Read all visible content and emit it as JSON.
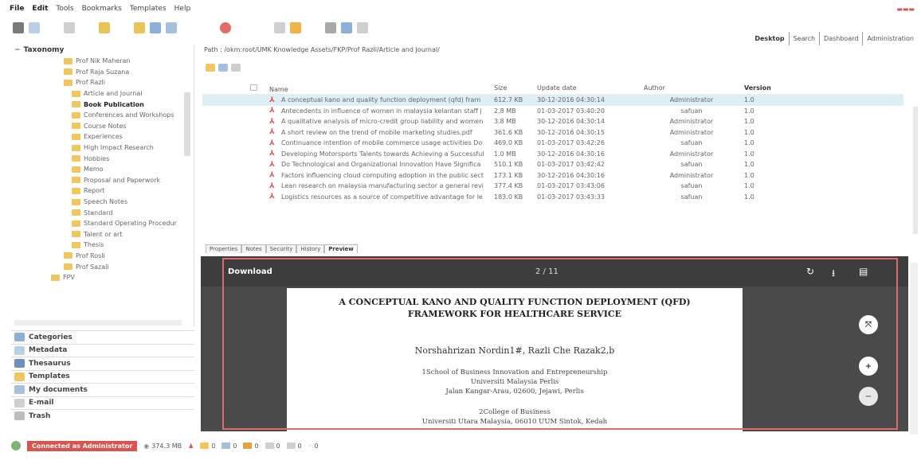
{
  "menu": [
    "File",
    "Edit",
    "Tools",
    "Bookmarks",
    "Templates",
    "Help"
  ],
  "nav_tabs": [
    "Desktop",
    "Search",
    "Dashboard",
    "Administration"
  ],
  "taxonomy": {
    "title": "Taxonomy",
    "items": [
      {
        "label": "Prof Nik Maheran",
        "indent": 1
      },
      {
        "label": "Prof Raja Suzana",
        "indent": 1
      },
      {
        "label": "Prof Razli",
        "indent": 1
      },
      {
        "label": "Article and Journal",
        "indent": 2
      },
      {
        "label": "Book Publication",
        "indent": 2
      },
      {
        "label": "Conferences and Workshops",
        "indent": 2
      },
      {
        "label": "Course Notes",
        "indent": 2
      },
      {
        "label": "Experiences",
        "indent": 2
      },
      {
        "label": "High Impact Research",
        "indent": 2
      },
      {
        "label": "Hobbies",
        "indent": 2
      },
      {
        "label": "Memo",
        "indent": 2
      },
      {
        "label": "Proposal and Paperwork",
        "indent": 2
      },
      {
        "label": "Report",
        "indent": 2
      },
      {
        "label": "Speech Notes",
        "indent": 2
      },
      {
        "label": "Standard",
        "indent": 2
      },
      {
        "label": "Standard Operating Procedur",
        "indent": 2
      },
      {
        "label": "Talent or art",
        "indent": 2
      },
      {
        "label": "Thesis",
        "indent": 2
      },
      {
        "label": "Prof Rosli",
        "indent": 1
      },
      {
        "label": "Prof Sazali",
        "indent": 1
      },
      {
        "label": "FPV",
        "indent": 0
      }
    ]
  },
  "accordion": [
    "Categories",
    "Metadata",
    "Thesaurus",
    "Templates",
    "My documents",
    "E-mail",
    "Trash"
  ],
  "status": {
    "connected": "Connected as Administrator",
    "size": "374.3 MB",
    "counts": [
      "0",
      "0",
      "0",
      "0",
      "0",
      "0"
    ]
  },
  "path": "Path : /okm:root/UMK Knowledge Assets/FKP/Prof Razli/Article and Journal/",
  "files": {
    "headers": {
      "name": "Name",
      "size": "Size",
      "date": "Update date",
      "author": "Author",
      "version": "Version"
    },
    "rows": [
      {
        "name": "A conceptual kano and quality function deployment (qfd) fram",
        "size": "612.7 KB",
        "date": "30-12-2016 04:30:14",
        "author": "Administrator",
        "version": "1.0"
      },
      {
        "name": "Antecedents in influence of women in malaysia kelantan staff j",
        "size": "2.8 MB",
        "date": "01-03-2017 03:40:20",
        "author": "safuan",
        "version": "1.0"
      },
      {
        "name": "A qualitative analysis of micro-credit group liability and women",
        "size": "3.8 MB",
        "date": "30-12-2016 04:30:14",
        "author": "Administrator",
        "version": "1.0"
      },
      {
        "name": "A short review on the trend of mobile marketing studies.pdf",
        "size": "361.6 KB",
        "date": "30-12-2016 04:30:15",
        "author": "Administrator",
        "version": "1.0"
      },
      {
        "name": "Continuance intention of mobile commerce usage activities Do",
        "size": "469.0 KB",
        "date": "01-03-2017 03:42:26",
        "author": "safuan",
        "version": "1.0"
      },
      {
        "name": "Developing Motorsports Talents towards Achieving a Successful",
        "size": "1.0 MB",
        "date": "30-12-2016 04:30:16",
        "author": "Administrator",
        "version": "1.0"
      },
      {
        "name": "Do Technological and Organizational Innovation Have Significa",
        "size": "510.1 KB",
        "date": "01-03-2017 03:42:42",
        "author": "safuan",
        "version": "1.0"
      },
      {
        "name": "Factors influencing cloud computing adoption in the public sect",
        "size": "173.1 KB",
        "date": "30-12-2016 04:30:16",
        "author": "Administrator",
        "version": "1.0"
      },
      {
        "name": "Lean research on malaysia manufacturing sector a general revi",
        "size": "377.4 KB",
        "date": "01-03-2017 03:43:06",
        "author": "safuan",
        "version": "1.0"
      },
      {
        "name": "Logistics resources as a source of competitive advantage for le",
        "size": "183.0 KB",
        "date": "01-03-2017 03:43:33",
        "author": "safuan",
        "version": "1.0"
      }
    ]
  },
  "detail_tabs": [
    "Properties",
    "Notes",
    "Security",
    "History",
    "Preview"
  ],
  "viewer": {
    "download": "Download",
    "page": "2 / 11",
    "title_line1": "A CONCEPTUAL KANO AND QUALITY FUNCTION DEPLOYMENT (QFD)",
    "title_line2": "FRAMEWORK FOR HEALTHCARE SERVICE",
    "authors": "Norshahrizan Nordin1#, Razli Che Razak2,b",
    "aff1": "1School of Business Innovation and Entrepreneurship",
    "aff2": "Universiti Malaysia Perlis",
    "aff3": "Jalan Kangar-Arau, 02600, Jejawi, Perlis",
    "aff4": "2College of Business",
    "aff5": "Universiti Utara Malaysia, 06010 UUM Sintok, Kedah"
  }
}
